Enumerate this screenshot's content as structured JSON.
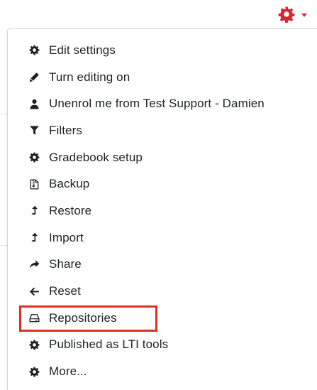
{
  "accent_color": "#d9272e",
  "highlight_color": "#e0301e",
  "trigger": {
    "icon": "gear-icon"
  },
  "menu": {
    "items": [
      {
        "id": "edit-settings",
        "label": "Edit settings",
        "icon": "gear-icon"
      },
      {
        "id": "turn-editing-on",
        "label": "Turn editing on",
        "icon": "pencil-icon"
      },
      {
        "id": "unenrol",
        "label": "Unenrol me from Test Support - Damien",
        "icon": "user-icon"
      },
      {
        "id": "filters",
        "label": "Filters",
        "icon": "filter-icon"
      },
      {
        "id": "gradebook-setup",
        "label": "Gradebook setup",
        "icon": "gear-icon"
      },
      {
        "id": "backup",
        "label": "Backup",
        "icon": "file-zip-icon"
      },
      {
        "id": "restore",
        "label": "Restore",
        "icon": "level-up-icon"
      },
      {
        "id": "import",
        "label": "Import",
        "icon": "level-up-icon"
      },
      {
        "id": "share",
        "label": "Share",
        "icon": "share-icon"
      },
      {
        "id": "reset",
        "label": "Reset",
        "icon": "arrow-left-icon"
      },
      {
        "id": "repositories",
        "label": "Repositories",
        "icon": "hard-drive-icon",
        "highlighted": true
      },
      {
        "id": "published-lti",
        "label": "Published as LTI tools",
        "icon": "gear-icon"
      },
      {
        "id": "more",
        "label": "More...",
        "icon": "gear-icon"
      }
    ]
  }
}
